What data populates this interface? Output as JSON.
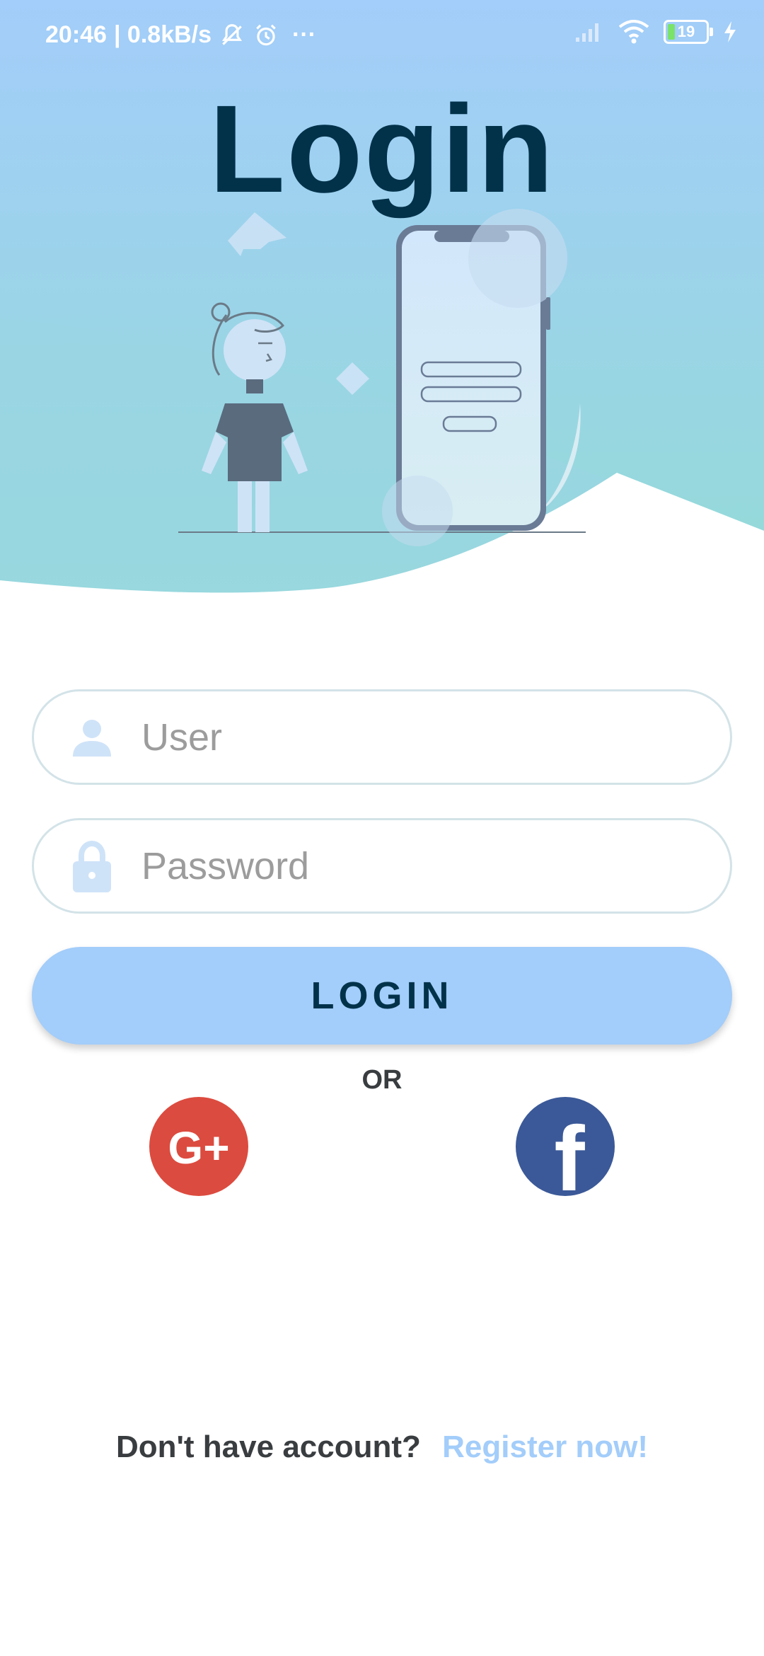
{
  "status_bar": {
    "time": "20:46",
    "network_speed": "| 0.8kB/s",
    "overflow": "···",
    "battery_level": "19"
  },
  "header": {
    "title": "Login"
  },
  "form": {
    "user_placeholder": "User",
    "password_placeholder": "Password",
    "login_label": "LOGIN",
    "or_label": "OR"
  },
  "social": {
    "google_label": "G+",
    "facebook_label": "f"
  },
  "footer": {
    "question": "Don't have account?",
    "register_link": "Register now!"
  },
  "colors": {
    "sky_top": "#a3cdfa",
    "sky_bottom": "#93dbd6",
    "title": "#02324a",
    "button": "#a3cdfa",
    "google": "#dc4b3f",
    "facebook": "#3b5998",
    "link": "#a3cdfa"
  }
}
